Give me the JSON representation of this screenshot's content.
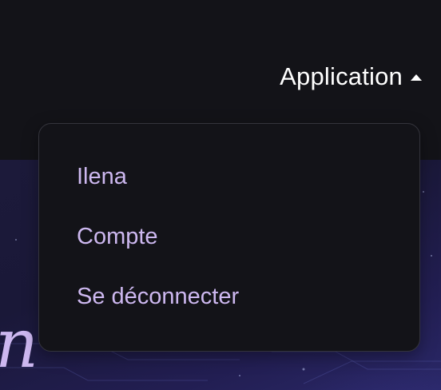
{
  "header": {
    "menu_label": "Application",
    "caret_icon": "caret-up-icon"
  },
  "dropdown": {
    "items": [
      {
        "label": "Ilena"
      },
      {
        "label": "Compte"
      },
      {
        "label": "Se déconnecter"
      }
    ]
  },
  "hero": {
    "glyph": "n"
  },
  "colors": {
    "background": "#131318",
    "menu_text": "#cdb8f0",
    "header_text": "#ffffff",
    "dropdown_border": "#34343c"
  }
}
